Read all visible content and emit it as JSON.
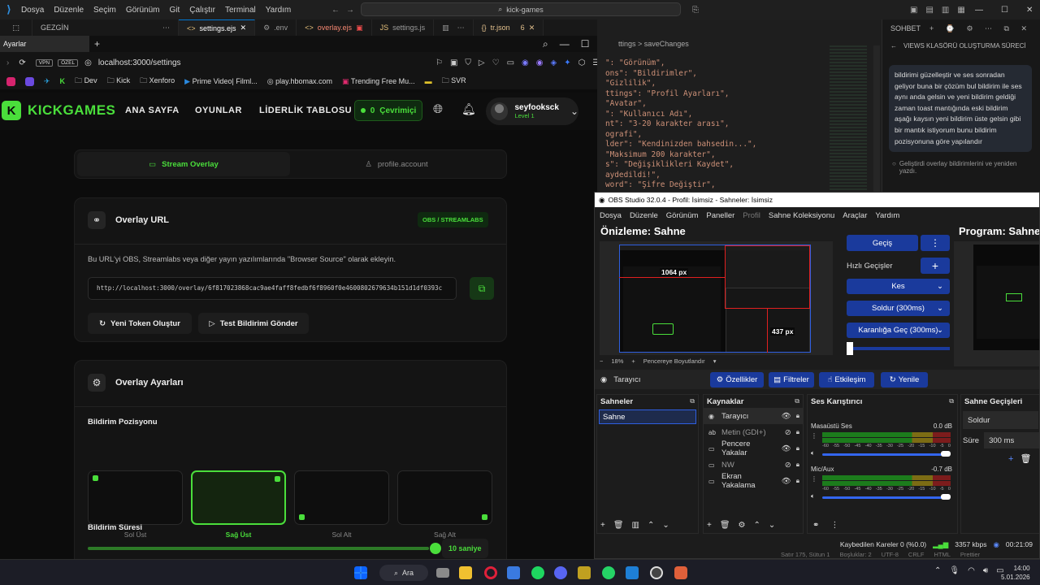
{
  "vscode": {
    "menu": [
      "Dosya",
      "Düzenle",
      "Seçim",
      "Görünüm",
      "Git",
      "Çalıştır",
      "Terminal",
      "Yardım"
    ],
    "search": "kick-games",
    "explorer_label": "GEZGİN",
    "tabs": [
      {
        "label": "settings.ejs",
        "active": true
      },
      {
        "label": ".env"
      },
      {
        "label": "overlay.ejs"
      },
      {
        "label": "settings.js"
      },
      {
        "label": "tr.json",
        "badge": "6"
      }
    ],
    "breadcrumb_tail": "ttings > saveChanges",
    "code": [
      "\": \"Görünüm\",",
      "ons\": \"Bildirimler\",",
      "\"Gizlilik\",",
      "ttings\": \"Profil Ayarları\",",
      "\"Avatar\",",
      "\": \"Kullanıcı Adı\",",
      "nt\": \"3-20 karakter arası\",",
      "ografi\",",
      "lder\": \"Kendinizden bahsedin...\",",
      "\"Maksimum 200 karakter\",",
      "s\": \"Değişiklikleri Kaydet\",",
      "aydedildi!\",",
      "word\": \"Şifre Değiştir\","
    ],
    "status": {
      "pos": "Satır 175, Sütun 1",
      "spaces": "Boşluklar: 2",
      "enc": "UTF-8",
      "eol": "CRLF",
      "lang": "HTML",
      "prettier": "Prettier"
    }
  },
  "copilot": {
    "title": "SOHBET",
    "subtitle": "VIEWS KLASÖRÜ OLUŞTURMA SÜRECİ",
    "message": "bildirimi güzelleştir ve ses sonradan geliyor buna bir çözüm bul bildirim ile ses aynı anda gelsin ve yeni bildirim geldiği zaman toast mantığında eski bildirim aşağı kaysın yeni bildirim üste gelsin gibi bir mantık istiyorum bunu bildirim pozisyonuna göre yapılandır",
    "status": "Geliştirdi overlay bildirimlerini ve yeniden yazdı."
  },
  "browser": {
    "tab_title": "Ayarlar",
    "url": "localhost:3000/settings",
    "bookmarks": [
      "Dev",
      "Kick",
      "Xenforo",
      "Prime Video| Filml...",
      "play.hbomax.com",
      "Trending Free Mu...",
      "SVR"
    ],
    "badges": [
      "VPN",
      "ÖZEL"
    ]
  },
  "site": {
    "logo": "KICKGAMES",
    "nav": [
      "ANA SAYFA",
      "OYUNLAR",
      "LİDERLİK TABLOSU"
    ],
    "online_count": "0",
    "online_label": "Çevrimiçi",
    "user_name": "seyfooksck",
    "user_level": "Level 1",
    "tab_overlay": "Stream Overlay",
    "tab_profile": "profile.account",
    "overlay_url_title": "Overlay URL",
    "overlay_badge": "OBS / STREAMLABS",
    "overlay_desc": "Bu URL'yi OBS, Streamlabs veya diğer yayın yazılımlarında \"Browser Source\" olarak ekleyin.",
    "overlay_url": "http://localhost:3000/overlay/6f817023868cac9ae4faff8fedbf6f8960f0e4600802679634b151d1df0393c",
    "btn_token": "Yeni Token Oluştur",
    "btn_test": "Test Bildirimi Gönder",
    "settings_title": "Overlay Ayarları",
    "position_label": "Bildirim Pozisyonu",
    "positions": [
      "Sol Üst",
      "Sağ Üst",
      "Sol Alt",
      "Sağ Alt"
    ],
    "selected_position": 1,
    "duration_label": "Bildirim Süresi",
    "duration_value": "10 saniye",
    "duration_fraction": 1.0,
    "accent": "#4ade3b"
  },
  "obs": {
    "title": "OBS Studio 32.0.4 - Profil: İsimsiz - Sahneler: İsimsiz",
    "menu": [
      "Dosya",
      "Düzenle",
      "Görünüm",
      "Paneller",
      "Profil",
      "Sahne Koleksiyonu",
      "Araçlar",
      "Yardım"
    ],
    "preview_label": "Önizleme: Sahne",
    "program_label": "Program: Sahne",
    "dim_w": "1064 px",
    "dim_h": "437 px",
    "zoom": "18%",
    "fit_label": "Pencereye Boyutlandır",
    "transition_btn": "Geçiş",
    "quick_transitions": "Hızlı Geçişler",
    "transitions": [
      "Kes",
      "Soldur (300ms)",
      "Karanlığa Geç (300ms)"
    ],
    "source_name": "Tarayıcı",
    "btn_props": "Özellikler",
    "btn_filters": "Filtreler",
    "btn_interact": "Etkileşim",
    "btn_refresh": "Yenile",
    "scenes_title": "Sahneler",
    "scenes": [
      "Sahne"
    ],
    "sources_title": "Kaynaklar",
    "sources": [
      "Tarayıcı",
      "Metin (GDI+)",
      "Pencere Yakalar",
      "NW",
      "Ekran Yakalama"
    ],
    "mixer_title": "Ses Karıştırıcı",
    "channels": [
      {
        "name": "Masaüstü Ses",
        "db": "0.0 dB"
      },
      {
        "name": "Mic/Aux",
        "db": "-0.7 dB"
      }
    ],
    "meter_ticks": [
      "-60",
      "-55",
      "-50",
      "-45",
      "-40",
      "-35",
      "-30",
      "-25",
      "-20",
      "-15",
      "-10",
      "-5",
      "0"
    ],
    "trans_title": "Sahne Geçişleri",
    "trans_select": "Soldur",
    "duration_label": "Süre",
    "duration_value": "300 ms",
    "status_frames": "Kaybedilen Kareler 0 (%0.0)",
    "status_bitrate": "3357 kbps",
    "status_time": "00:21:09"
  },
  "taskbar": {
    "search": "Ara",
    "time": "14:00",
    "date": "5.01.2026"
  }
}
